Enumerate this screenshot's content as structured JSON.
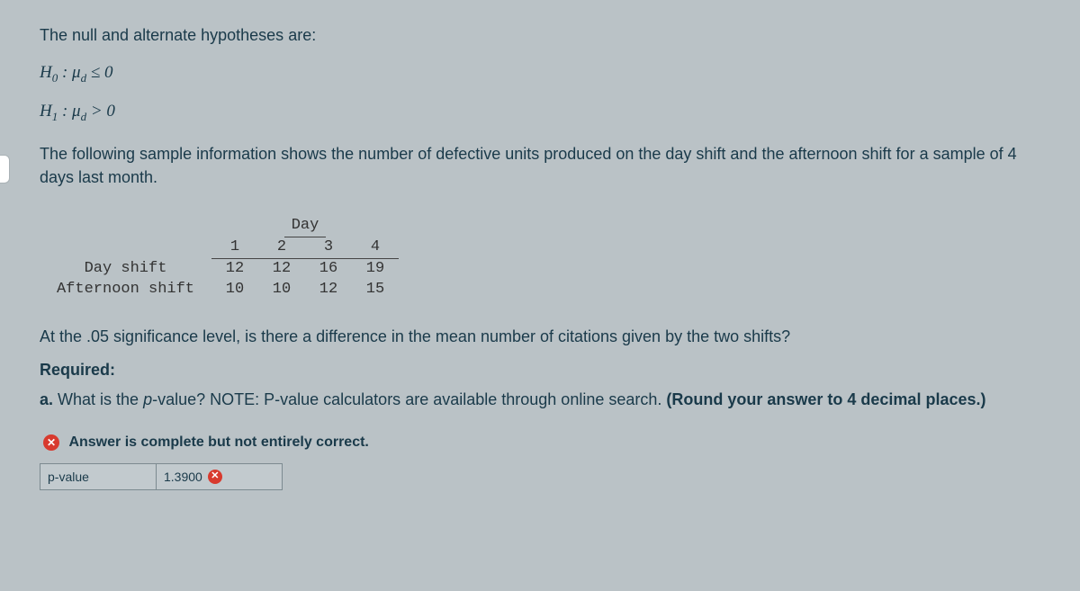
{
  "intro": "The null and alternate hypotheses are:",
  "hypotheses": {
    "null_label": "H",
    "null_sub": "0",
    "null_rest": " : μ",
    "mu_sub": "d",
    "null_op": " ≤ 0",
    "alt_label": "H",
    "alt_sub": "1",
    "alt_rest": " : μ",
    "alt_op": " > 0"
  },
  "paragraph": "The following sample information shows the number of defective units produced on the day shift and the afternoon shift for a sample of 4 days last month.",
  "table": {
    "group_header": "Day",
    "col_headers": [
      "1",
      "2",
      "3",
      "4"
    ],
    "rows": [
      {
        "label": "Day shift",
        "values": [
          "12",
          "12",
          "16",
          "19"
        ]
      },
      {
        "label": "Afternoon shift",
        "values": [
          "10",
          "10",
          "12",
          "15"
        ]
      }
    ]
  },
  "sig_question": "At the .05 significance level, is there a difference in the mean number of citations given by the two shifts?",
  "required_label": "Required:",
  "question_a_prefix": "a. ",
  "question_a_text1": "What is the ",
  "question_a_em": "p",
  "question_a_text2": "-value? NOTE: P-value calculators are available through online search. ",
  "question_a_bold": "(Round your answer to 4 decimal places.)",
  "feedback": {
    "icon": "✕",
    "message": "Answer is complete but not entirely correct."
  },
  "answer": {
    "label": "p-value",
    "value": "1.3900",
    "status_icon": "✕"
  },
  "chart_data": {
    "type": "table",
    "title": "Defective units by shift and day",
    "columns": [
      "Day 1",
      "Day 2",
      "Day 3",
      "Day 4"
    ],
    "rows": {
      "Day shift": [
        12,
        12,
        16,
        19
      ],
      "Afternoon shift": [
        10,
        10,
        12,
        15
      ]
    }
  }
}
